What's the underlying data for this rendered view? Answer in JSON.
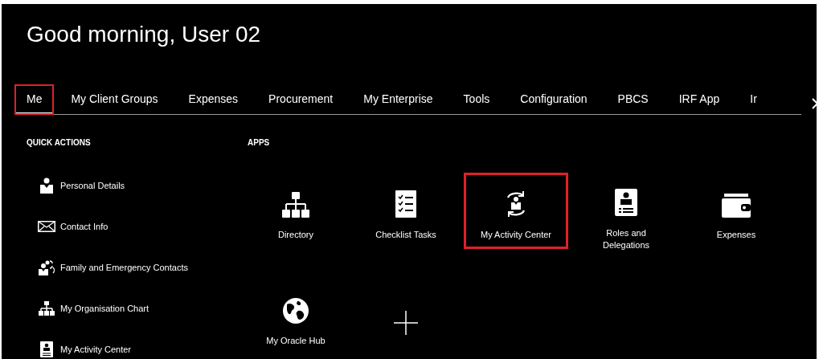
{
  "greeting": "Good morning, User 02",
  "tabs": [
    {
      "label": "Me",
      "selected": true,
      "highlighted": true
    },
    {
      "label": "My Client Groups",
      "selected": false,
      "highlighted": false
    },
    {
      "label": "Expenses",
      "selected": false,
      "highlighted": false
    },
    {
      "label": "Procurement",
      "selected": false,
      "highlighted": false
    },
    {
      "label": "My Enterprise",
      "selected": false,
      "highlighted": false
    },
    {
      "label": "Tools",
      "selected": false,
      "highlighted": false
    },
    {
      "label": "Configuration",
      "selected": false,
      "highlighted": false
    },
    {
      "label": "PBCS",
      "selected": false,
      "highlighted": false
    },
    {
      "label": "IRF App",
      "selected": false,
      "highlighted": false
    },
    {
      "label": "Ir",
      "selected": false,
      "highlighted": false
    }
  ],
  "quick_actions": {
    "title": "QUICK ACTIONS",
    "items": [
      {
        "label": "Personal Details"
      },
      {
        "label": "Contact Info"
      },
      {
        "label": "Family and Emergency Contacts"
      },
      {
        "label": "My Organisation Chart"
      },
      {
        "label": "My Activity Center"
      }
    ]
  },
  "apps": {
    "title": "APPS",
    "items": [
      {
        "kind": "app",
        "label": "Directory",
        "highlighted": false
      },
      {
        "kind": "app",
        "label": "Checklist Tasks",
        "highlighted": false
      },
      {
        "kind": "app",
        "label": "My Activity Center",
        "highlighted": true
      },
      {
        "kind": "app",
        "label": "Roles and Delegations",
        "highlighted": false
      },
      {
        "kind": "app",
        "label": "Expenses",
        "highlighted": false
      },
      {
        "kind": "app",
        "label": "My Oracle Hub",
        "highlighted": false
      },
      {
        "kind": "add"
      }
    ]
  }
}
